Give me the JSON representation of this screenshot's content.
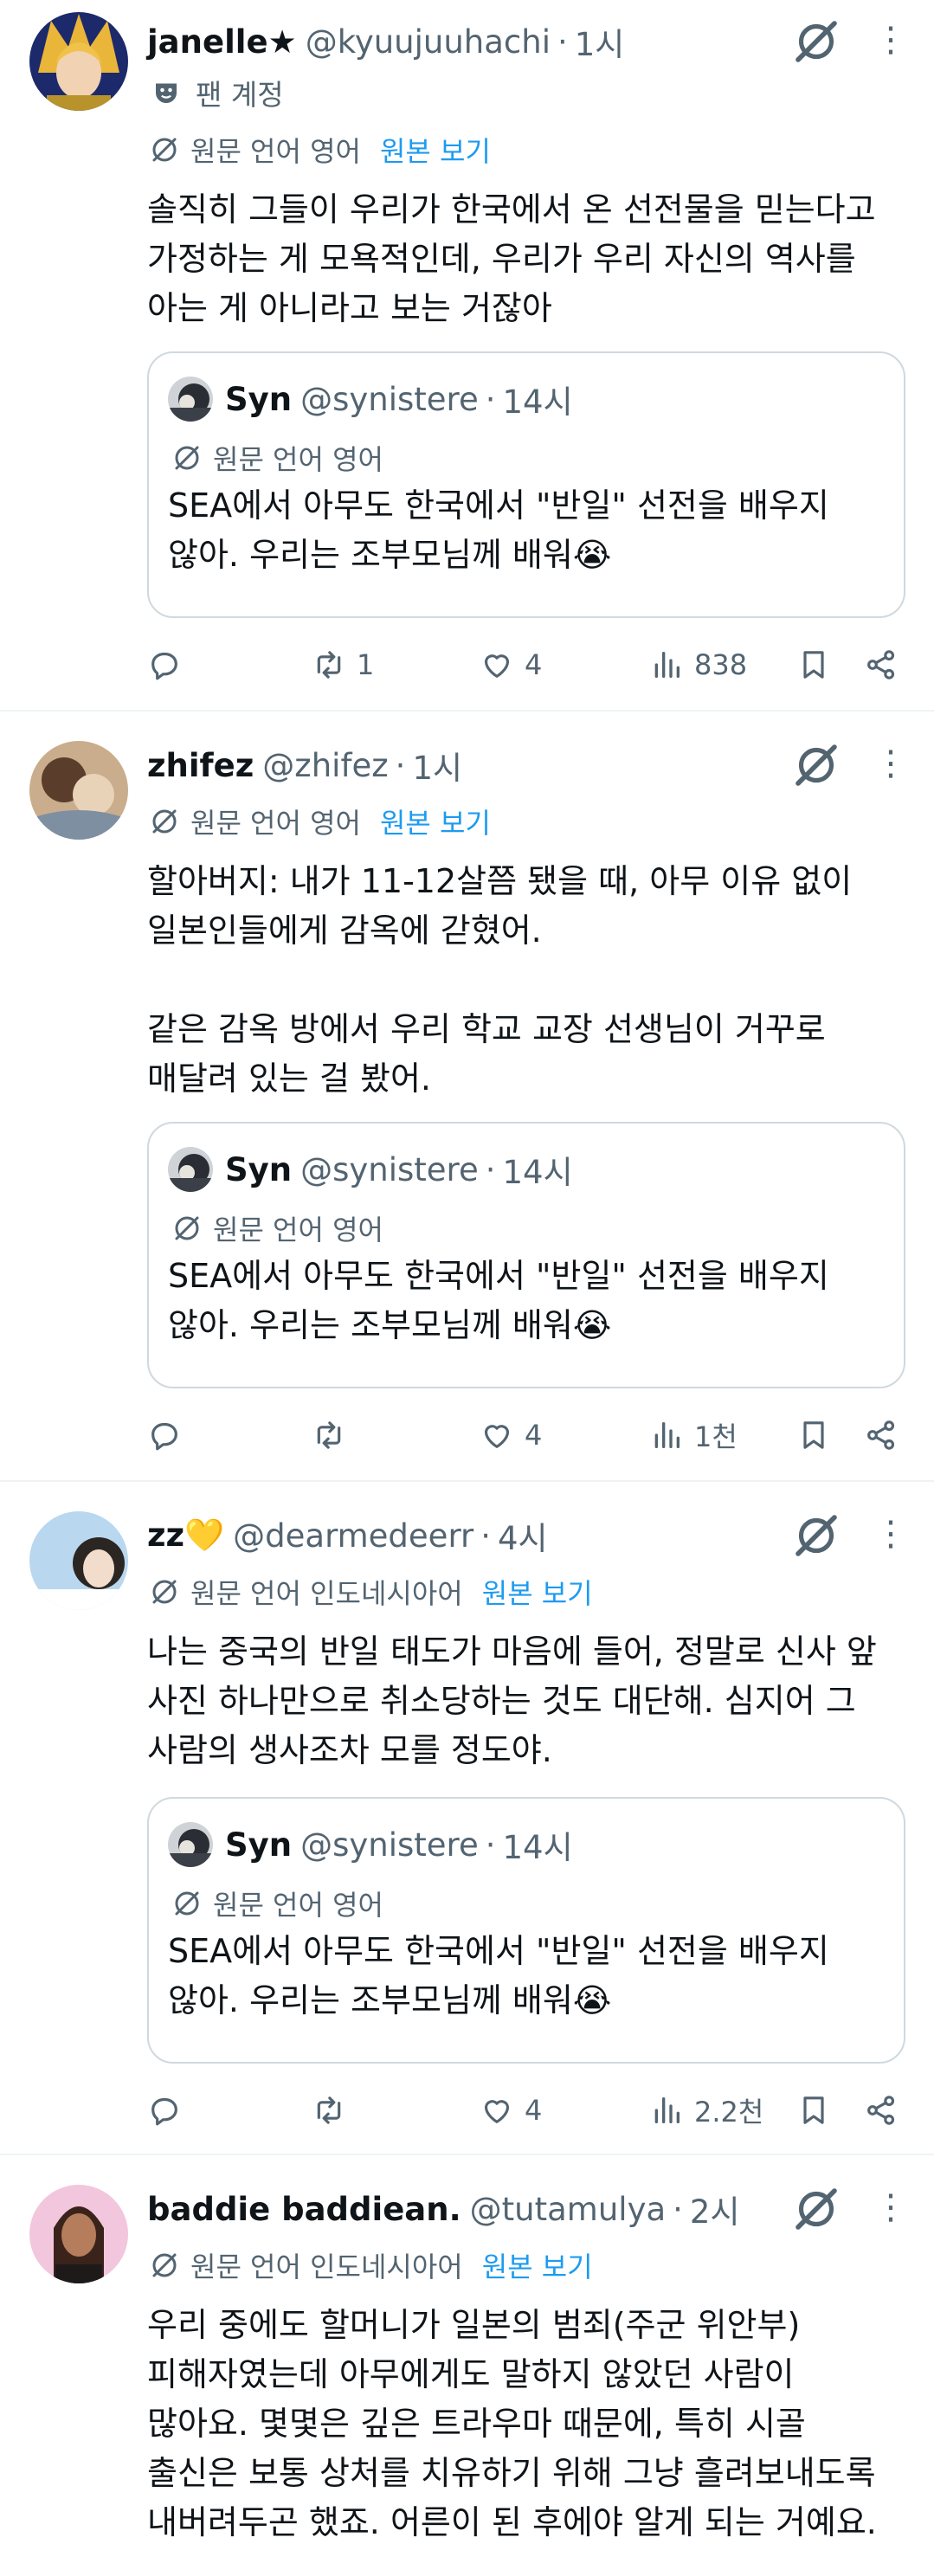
{
  "posts": [
    {
      "name": "janelle★",
      "handle": "@kyuujuuhachi",
      "time": "1시",
      "fan_badge": "팬 계정",
      "translation": {
        "label": "원문 언어 영어",
        "show_original": "원본 보기"
      },
      "text": "솔직히 그들이 우리가 한국에서 온 선전물을 믿는다고\n가정하는 게 모욕적인데, 우리가 우리 자신의 역사를\n아는 게 아니라고 보는 거잖아",
      "quote": {
        "name": "Syn",
        "handle": "@synistere",
        "time": "14시",
        "translation": "원문 언어 영어",
        "text": "SEA에서 아무도 한국에서 \"반일\" 선전을 배우지\n않아. 우리는 조부모님께 배워😭"
      },
      "stats": {
        "replies": "",
        "reposts": "1",
        "likes": "4",
        "views": "838"
      }
    },
    {
      "name": "zhifez",
      "handle": "@zhifez",
      "time": "1시",
      "translation": {
        "label": "원문 언어 영어",
        "show_original": "원본 보기"
      },
      "text": "할아버지: 내가 11-12살쯤 됐을 때, 아무 이유 없이\n일본인들에게 감옥에 갇혔어.\n\n같은 감옥 방에서 우리 학교 교장 선생님이 거꾸로\n매달려 있는 걸 봤어.",
      "quote": {
        "name": "Syn",
        "handle": "@synistere",
        "time": "14시",
        "translation": "원문 언어 영어",
        "text": "SEA에서 아무도 한국에서 \"반일\" 선전을 배우지\n않아. 우리는 조부모님께 배워😭"
      },
      "stats": {
        "replies": "",
        "reposts": "",
        "likes": "4",
        "views": "1천"
      }
    },
    {
      "name": "zz💛",
      "handle": "@dearmedeerr",
      "time": "4시",
      "translation": {
        "label": "원문 언어 인도네시아어",
        "show_original": "원본 보기"
      },
      "text": "나는 중국의 반일 태도가 마음에 들어, 정말로 신사 앞\n사진 하나만으로 취소당하는 것도 대단해. 심지어 그\n사람의 생사조차 모를 정도야.",
      "quote": {
        "name": "Syn",
        "handle": "@synistere",
        "time": "14시",
        "translation": "원문 언어 영어",
        "text": "SEA에서 아무도 한국에서 \"반일\" 선전을 배우지\n않아. 우리는 조부모님께 배워😭"
      },
      "stats": {
        "replies": "",
        "reposts": "",
        "likes": "4",
        "views": "2.2천"
      }
    },
    {
      "name": "baddie baddiean.",
      "handle": "@tutamulya",
      "time": "2시",
      "translation": {
        "label": "원문 언어 인도네시아어",
        "show_original": "원본 보기"
      },
      "text": "우리 중에도 할머니가 일본의 범죄(주군 위안부)\n피해자였는데 아무에게도 말하지 않았던 사람이\n많아요. 몇몇은 깊은 트라우마 때문에, 특히 시골\n출신은 보통 상처를 치유하기 위해 그냥 흘려보내도록\n내버려두곤 했죠. 어른이 된 후에야 알게 되는 거예요."
    }
  ],
  "icons": {
    "reply": "reply-icon",
    "repost": "repost-icon",
    "like": "heart-icon",
    "views": "views-icon",
    "bookmark": "bookmark-icon",
    "share": "share-icon",
    "grok": "grok-icon",
    "more": "more-icon",
    "translate": "translate-icon"
  },
  "colors": {
    "link": "#1d9bf0",
    "secondary": "#536471",
    "border": "#cfd9de"
  }
}
